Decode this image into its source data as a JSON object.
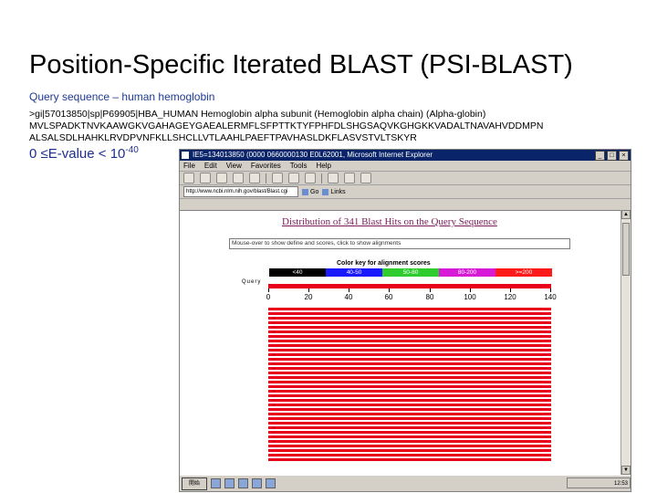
{
  "slide": {
    "title": "Position-Specific Iterated BLAST (PSI-BLAST)",
    "subtitle": "Query sequence – human hemoglobin",
    "seq_header": ">gi|57013850|sp|P69905|HBA_HUMAN Hemoglobin alpha subunit (Hemoglobin alpha chain) (Alpha-globin)",
    "seq_line1": "MVLSPADKTNVKAAWGKVGAHAGEYGAEALERMFLSFPTTKTYFPHFDLSHGSAQVKGHGKKVADALTNAVAHVDDMPN",
    "seq_line2": "ALSALSDLHAHKLRVDPVNFKLLSHCLLVTLAAHLPAEFTPAVHASLDKFLASVSTVLTSKYR",
    "evalue_prefix": "0 ≤E-value < 10",
    "evalue_exp": "-40"
  },
  "browser": {
    "window_title": "IE5=134013850 (0000 0660000130 E0L62001, Microsoft Internet Explorer",
    "menu": [
      "File",
      "Edit",
      "View",
      "Favorites",
      "Tools",
      "Help"
    ],
    "address": "http://www.ncbi.nlm.nih.gov/blast/Blast.cgi",
    "links": [
      "Go",
      "Links"
    ],
    "page": {
      "distribution_title": "Distribution of 341 Blast Hits on the Query Sequence",
      "mouse_hint": "Mouse-over to show define and scores, click to show alignments",
      "key_title": "Color key for alignment scores",
      "key": [
        {
          "label": "<40",
          "color": "#000000"
        },
        {
          "label": "40-50",
          "color": "#1a1aff"
        },
        {
          "label": "50-80",
          "color": "#2ecc2e"
        },
        {
          "label": "80-200",
          "color": "#d61ad6"
        },
        {
          "label": ">=200",
          "color": "#ff1a1a"
        }
      ],
      "query_label": "Query",
      "ticks": [
        "0",
        "20",
        "40",
        "60",
        "80",
        "100",
        "120",
        "140"
      ],
      "hit_color": "#e8001a",
      "visible_hit_rows": 34
    },
    "taskbar": {
      "start_label": "開始",
      "clock": "12:53"
    }
  }
}
